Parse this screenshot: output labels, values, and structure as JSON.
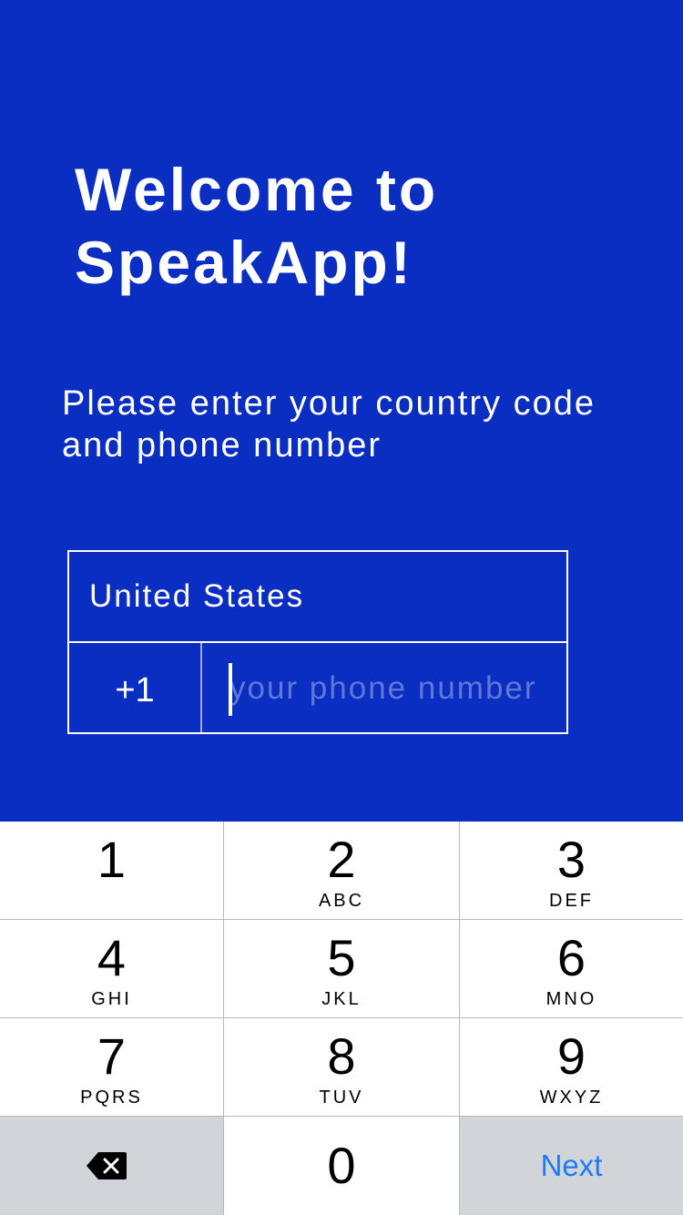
{
  "header": {
    "title_line1": "Welcome to",
    "title_line2": "SpeakApp!",
    "subtitle": "Please enter your country code and phone number"
  },
  "form": {
    "country": "United States",
    "country_code": "+1",
    "phone_value": "",
    "phone_placeholder": "your phone number"
  },
  "keypad": {
    "keys": [
      {
        "num": "1",
        "letters": ""
      },
      {
        "num": "2",
        "letters": "ABC"
      },
      {
        "num": "3",
        "letters": "DEF"
      },
      {
        "num": "4",
        "letters": "GHI"
      },
      {
        "num": "5",
        "letters": "JKL"
      },
      {
        "num": "6",
        "letters": "MNO"
      },
      {
        "num": "7",
        "letters": "PQRS"
      },
      {
        "num": "8",
        "letters": "TUV"
      },
      {
        "num": "9",
        "letters": "WXYZ"
      },
      {
        "num": "0",
        "letters": ""
      }
    ],
    "backspace_icon": "backspace-icon",
    "next_label": "Next"
  },
  "colors": {
    "background": "#0a2ec2",
    "accent": "#1b7cf2",
    "keypad_gray": "#d1d4d9"
  }
}
